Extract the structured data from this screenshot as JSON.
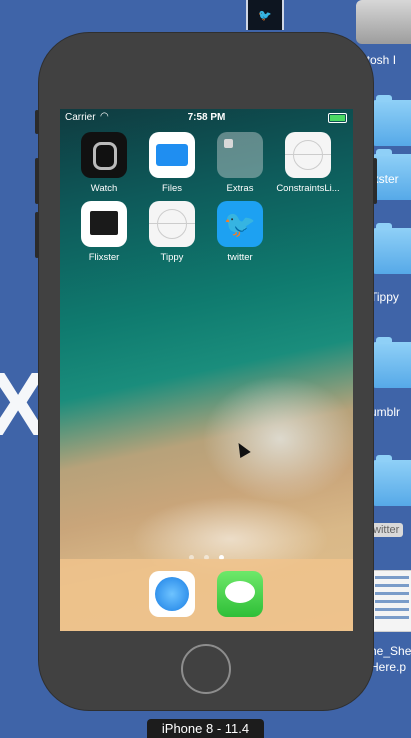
{
  "desktop": {
    "hd_label": "ntosh I",
    "folders": [
      {
        "label": "ixster"
      },
      {
        "label": "Tippy"
      },
      {
        "label": "umblr"
      }
    ],
    "twitter_tag": "witter",
    "doc_label_1": "he_She",
    "doc_label_2": "Here.p",
    "device_tag": "iPhone 8 - 11.4"
  },
  "status_bar": {
    "carrier": "Carrier",
    "time": "7:58 PM"
  },
  "apps": [
    {
      "label": "Watch",
      "icon": "watch-icon"
    },
    {
      "label": "Files",
      "icon": "files-icon"
    },
    {
      "label": "Extras",
      "icon": "extras-folder-icon"
    },
    {
      "label": "ConstraintsLi...",
      "icon": "placeholder-app-icon"
    },
    {
      "label": "Flixster",
      "icon": "clapperboard-icon"
    },
    {
      "label": "Tippy",
      "icon": "placeholder-app-icon"
    },
    {
      "label": "twitter",
      "icon": "twitter-bird-icon"
    }
  ],
  "dock": [
    {
      "name": "Safari",
      "icon": "safari-compass-icon"
    },
    {
      "name": "Messages",
      "icon": "messages-bubble-icon"
    }
  ],
  "page_indicator": {
    "pages": 3,
    "current": 3
  },
  "colors": {
    "desktop_bg": "#3f64a8",
    "phone_body": "#414141",
    "twitter_blue": "#1da1f2",
    "battery_green": "#4cd964"
  }
}
